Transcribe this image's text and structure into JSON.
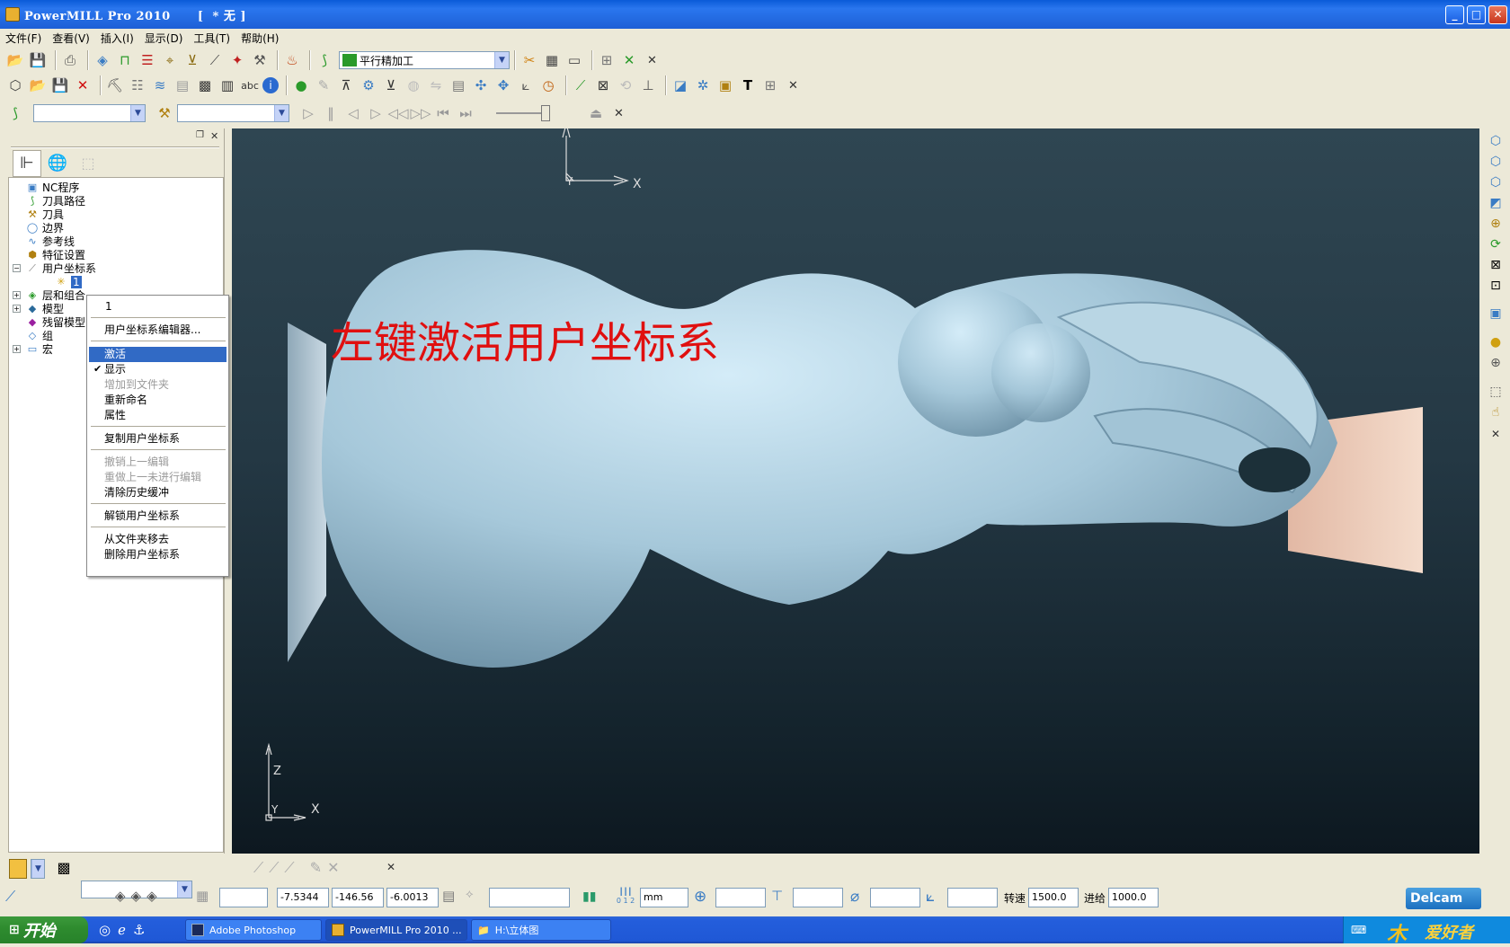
{
  "window": {
    "title": "PowerMILL Pro 2010      [  * 无 ]"
  },
  "menu": [
    "文件(F)",
    "查看(V)",
    "插入(I)",
    "显示(D)",
    "工具(T)",
    "帮助(H)"
  ],
  "toolbar1": {
    "strategy_combo": "平行精加工"
  },
  "explorer": {
    "items": [
      "NC程序",
      "刀具路径",
      "刀具",
      "边界",
      "参考线",
      "特征设置",
      "用户坐标系",
      "层和组合",
      "模型",
      "残留模型",
      "组",
      "宏"
    ],
    "ucs_child": "1"
  },
  "context_menu": {
    "header": "1",
    "items": [
      "用户坐标系编辑器...",
      "激活",
      "显示",
      "增加到文件夹",
      "重新命名",
      "属性",
      "复制用户坐标系",
      "撤销上一编辑",
      "重做上一未进行编辑",
      "清除历史缓冲",
      "解锁用户坐标系",
      "从文件夹移去",
      "删除用户坐标系"
    ],
    "selected": "激活",
    "checked": "显示",
    "disabled": [
      "增加到文件夹",
      "撤销上一编辑",
      "重做上一未进行编辑"
    ]
  },
  "viewport": {
    "annotation": "左键激活用户坐标系",
    "top_axis": {
      "y": "Y",
      "x": "X"
    },
    "triad": {
      "z": "Z",
      "y": "Y",
      "x": "X"
    },
    "model_color": "#a9c9d9"
  },
  "statusbar": {
    "coord_x": "-7.5344",
    "coord_y": "-146.56",
    "coord_z": "-6.0013",
    "units": "mm",
    "scale_label": "0 1 2",
    "speed_label": "转速",
    "speed_value": "1500.0",
    "feed_label": "进给",
    "feed_value": "1000.0",
    "brand": "Delcam"
  },
  "taskbar": {
    "start": "开始",
    "tasks": [
      "Adobe Photoshop",
      "PowerMILL Pro 2010 ...",
      "H:\\立体图"
    ],
    "watermark": "爱好者"
  }
}
